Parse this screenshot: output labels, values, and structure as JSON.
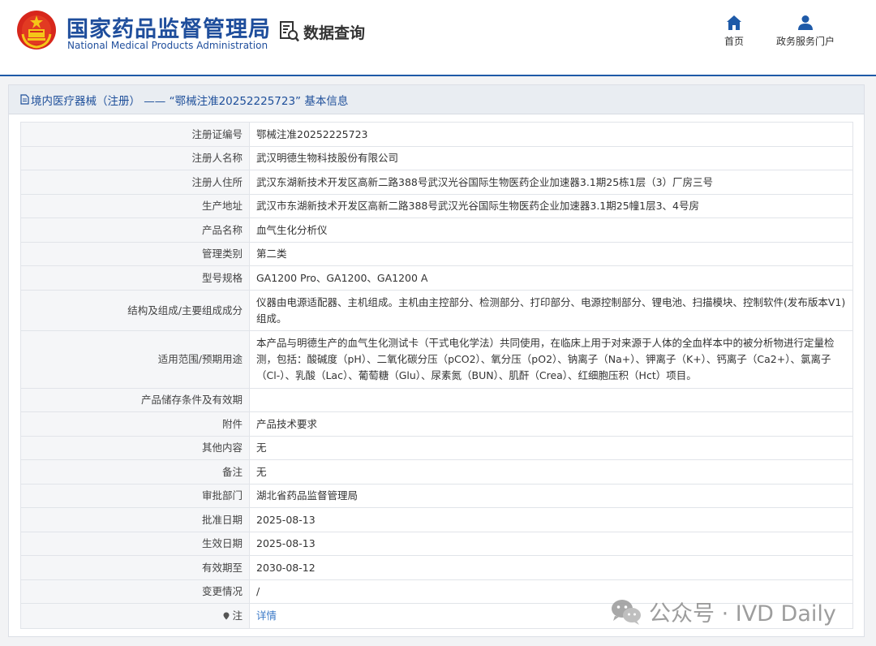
{
  "header": {
    "brand_cn": "国家药品监督管理局",
    "brand_en": "National Medical Products Administration",
    "section_title": "数据查询",
    "nav": [
      {
        "label": "首页",
        "icon": "home-icon"
      },
      {
        "label": "政务服务门户",
        "icon": "user-icon"
      }
    ]
  },
  "panel": {
    "title": "境内医疗器械（注册） —— “鄂械注准20252225723” 基本信息"
  },
  "rows": [
    {
      "key": "注册证编号",
      "value": "鄂械注准20252225723"
    },
    {
      "key": "注册人名称",
      "value": "武汉明德生物科技股份有限公司"
    },
    {
      "key": "注册人住所",
      "value": "武汉东湖新技术开发区高新二路388号武汉光谷国际生物医药企业加速器3.1期25栋1层（3）厂房三号"
    },
    {
      "key": "生产地址",
      "value": "武汉市东湖新技术开发区高新二路388号武汉光谷国际生物医药企业加速器3.1期25幢1层3、4号房"
    },
    {
      "key": "产品名称",
      "value": "血气生化分析仪"
    },
    {
      "key": "管理类别",
      "value": "第二类"
    },
    {
      "key": "型号规格",
      "value": "GA1200 Pro、GA1200、GA1200 A"
    },
    {
      "key": "结构及组成/主要组成成分",
      "value": "仪器由电源适配器、主机组成。主机由主控部分、检测部分、打印部分、电源控制部分、锂电池、扫描模块、控制软件(发布版本V1)组成。"
    },
    {
      "key": "适用范围/预期用途",
      "value": "本产品与明德生产的血气生化测试卡（干式电化学法）共同使用，在临床上用于对来源于人体的全血样本中的被分析物进行定量检测，包括：酸碱度（pH）、二氧化碳分压（pCO2）、氧分压（pO2）、钠离子（Na+）、钾离子（K+）、钙离子（Ca2+）、氯离子（Cl-）、乳酸（Lac）、葡萄糖（Glu）、尿素氮（BUN）、肌酐（Crea）、红细胞压积（Hct）项目。"
    },
    {
      "key": "产品储存条件及有效期",
      "value": ""
    },
    {
      "key": "附件",
      "value": "产品技术要求"
    },
    {
      "key": "其他内容",
      "value": "无"
    },
    {
      "key": "备注",
      "value": "无"
    },
    {
      "key": "审批部门",
      "value": "湖北省药品监督管理局"
    },
    {
      "key": "批准日期",
      "value": "2025-08-13"
    },
    {
      "key": "生效日期",
      "value": "2025-08-13"
    },
    {
      "key": "有效期至",
      "value": "2030-08-12"
    },
    {
      "key": "变更情况",
      "value": "/"
    },
    {
      "key": "注",
      "value": "详情"
    }
  ],
  "watermark": {
    "text": "公众号 · IVD Daily"
  }
}
